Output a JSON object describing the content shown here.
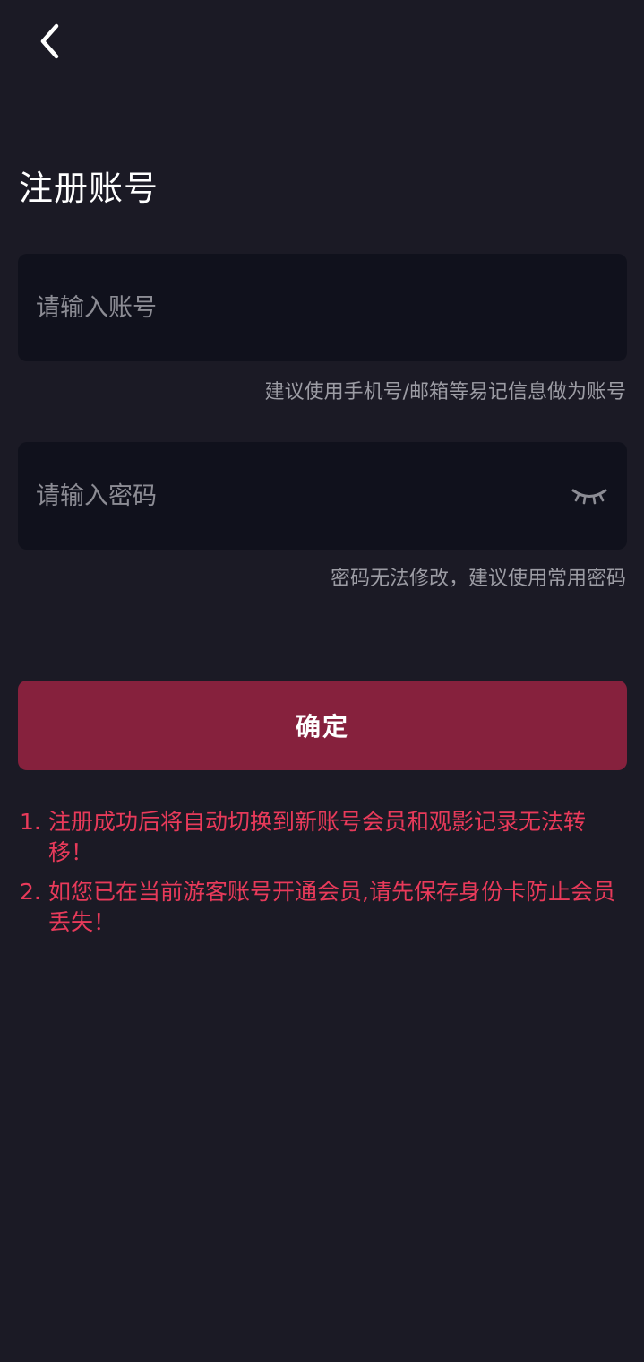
{
  "page": {
    "title": "注册账号"
  },
  "nav": {
    "back_icon": "chevron-left-icon"
  },
  "account": {
    "placeholder": "请输入账号",
    "value": "",
    "hint": "建议使用手机号/邮箱等易记信息做为账号"
  },
  "password": {
    "placeholder": "请输入密码",
    "value": "",
    "visibility_icon": "eye-closed-icon",
    "hint": "密码无法修改，建议使用常用密码"
  },
  "confirm_button": {
    "label": "确定"
  },
  "notices": [
    {
      "number": "1.",
      "text": "注册成功后将自动切换到新账号会员和观影记录无法转移！"
    },
    {
      "number": "2.",
      "text": "如您已在当前游客账号开通会员,请先保存身份卡防止会员丢失！"
    }
  ],
  "colors": {
    "background": "#1b1a25",
    "input_background": "#10111c",
    "button": "#86213d",
    "notice": "#e83a5a",
    "hint": "#9c9ca4"
  }
}
